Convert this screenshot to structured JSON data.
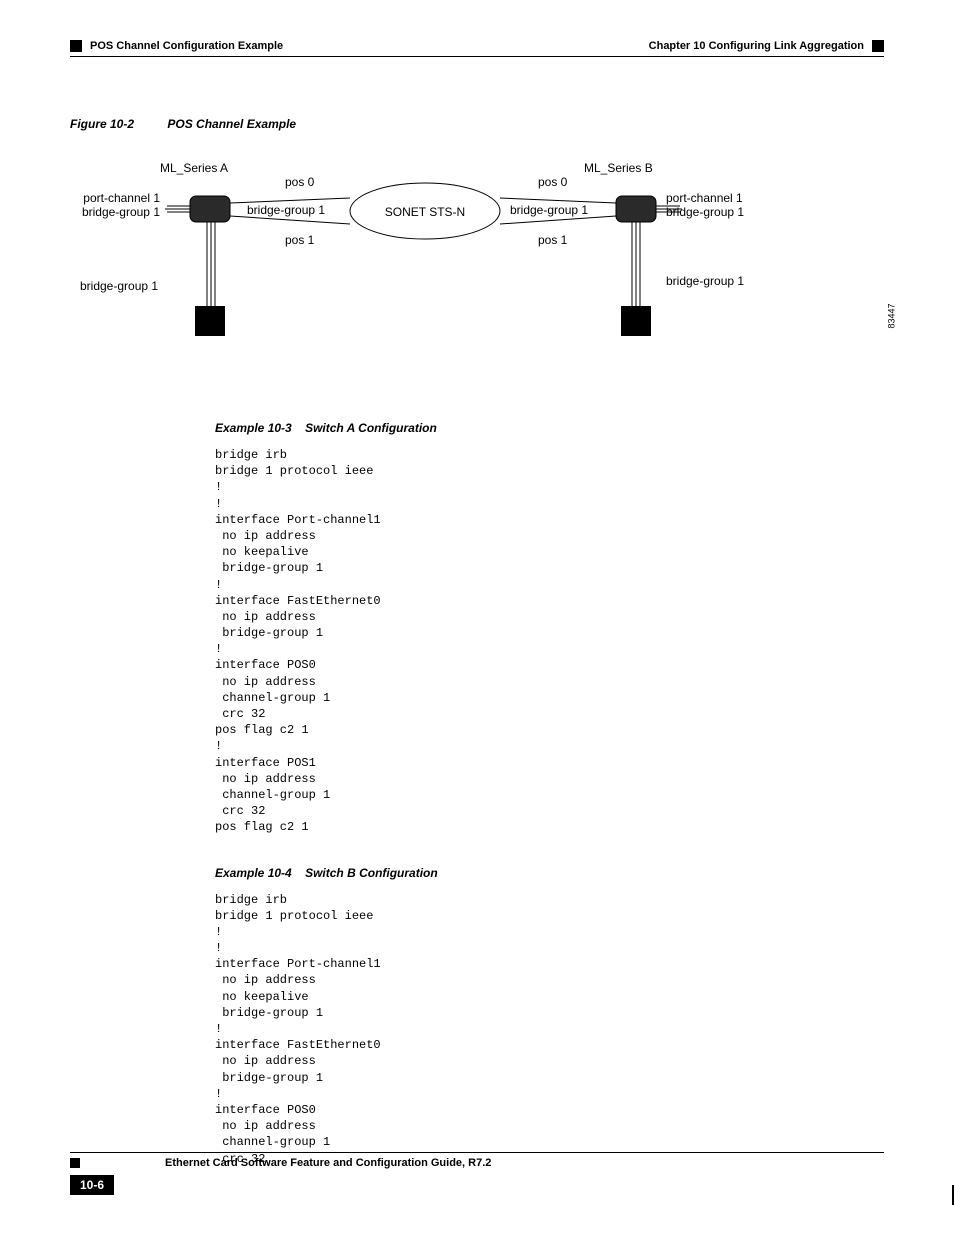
{
  "header": {
    "left": "POS Channel Configuration Example",
    "right_prefix": "Chapter 10",
    "right_title": "Configuring Link Aggregation"
  },
  "figure": {
    "caption_num": "Figure 10-2",
    "caption_title": "POS Channel Example",
    "labels": {
      "ml_a": "ML_Series A",
      "ml_b": "ML_Series B",
      "pc_left": "port-channel 1\nbridge-group 1",
      "pc_right": "port-channel 1\nbridge-group 1",
      "pos0_a": "pos 0",
      "pos1_a": "pos 1",
      "pos0_b": "pos 0",
      "pos1_b": "pos 1",
      "bg_a_top": "bridge-group 1",
      "bg_b_top": "bridge-group 1",
      "bg_a_bottom": "bridge-group 1",
      "bg_b_bottom": "bridge-group 1",
      "cloud": "SONET STS-N",
      "figure_id": "83447"
    }
  },
  "example3": {
    "num": "Example 10-3",
    "title": "Switch A Configuration",
    "code": "bridge irb\nbridge 1 protocol ieee\n!\n!\ninterface Port-channel1\n no ip address\n no keepalive\n bridge-group 1\n!\ninterface FastEthernet0\n no ip address\n bridge-group 1\n!\ninterface POS0\n no ip address\n channel-group 1\n crc 32\npos flag c2 1\n!\ninterface POS1\n no ip address\n channel-group 1\n crc 32\npos flag c2 1"
  },
  "example4": {
    "num": "Example 10-4",
    "title": "Switch B Configuration",
    "code": "bridge irb\nbridge 1 protocol ieee\n!\n!\ninterface Port-channel1\n no ip address\n no keepalive\n bridge-group 1\n!\ninterface FastEthernet0\n no ip address\n bridge-group 1\n!\ninterface POS0\n no ip address\n channel-group 1\n crc 32"
  },
  "footer": {
    "title": "Ethernet Card Software Feature and Configuration Guide, R7.2",
    "page_num": "10-6"
  }
}
